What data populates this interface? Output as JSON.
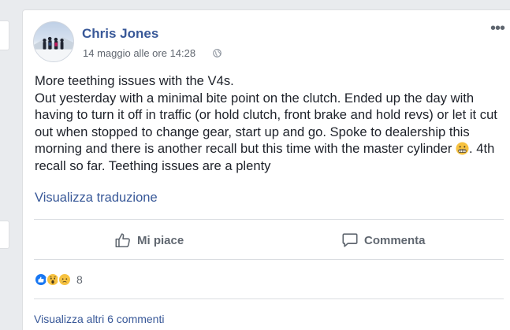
{
  "post": {
    "author": "Chris Jones",
    "timestamp": "14 maggio alle ore 14:28",
    "body_line1": "More teething issues with the V4s.",
    "body_line2_before_emoji": "Out yesterday with a minimal bite point on the clutch. Ended up the day with having to turn it off in traffic (or hold clutch, front brake and hold revs) or let it cut out when stopped to change gear, start up and go. Spoke to dealership this morning and there is another recall but this time with the master cylinder",
    "body_after_emoji": ". 4th recall so far. Teething issues are a plenty",
    "translate_link": "Visualizza traduzione",
    "more_options": "•••"
  },
  "actions": {
    "like_label": "Mi piace",
    "comment_label": "Commenta"
  },
  "reactions": {
    "count": "8",
    "icons": [
      "like-icon",
      "wow-icon",
      "sad-icon"
    ],
    "colors": {
      "like": "#1877f2",
      "emoji_yellow": "#f7c240"
    }
  },
  "comments": {
    "view_more": "Visualizza altri 6 commenti"
  },
  "colors": {
    "link": "#385898",
    "text": "#1d2129",
    "muted": "#616770",
    "background": "#e9ebee"
  }
}
